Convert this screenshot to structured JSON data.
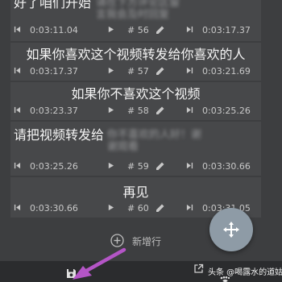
{
  "rows": [
    {
      "subtitle": "好了咱们开始",
      "subtitle_blurred": "请在下方评论区留言我会及时回复",
      "start_time": "0:03:11.04",
      "index": "# 56",
      "end_time": "0:03:17.37"
    },
    {
      "subtitle": "如果你喜欢这个视频转发给你喜欢的人",
      "start_time": "0:03:17.37",
      "index": "# 57",
      "end_time": "0:03:21.69"
    },
    {
      "subtitle": "如果你不喜欢这个视频",
      "start_time": "0:03:23.37",
      "index": "# 58",
      "end_time": "0:03:25.26"
    },
    {
      "subtitle": "请把视频转发给",
      "subtitle_blurred": "你不喜欢的人好！谢谢观看",
      "start_time": "0:03:25.26",
      "index": "# 59",
      "end_time": "0:03:30.66"
    },
    {
      "subtitle": "再见",
      "start_time": "0:03:30.66",
      "index": "# 60",
      "end_time": "0:03:31.05"
    }
  ],
  "add_row_label": "新增行",
  "watermark": "头条 @喝露水的道姑",
  "colors": {
    "background": "#3d3e40",
    "card": "#47484a",
    "fab": "#8e9ba6",
    "arrow": "#b455c6"
  },
  "icons": [
    "skip-start-icon",
    "play-icon",
    "pencil-icon",
    "skip-end-icon",
    "add-circle-icon",
    "move-arrows-icon",
    "save-icon",
    "open-external-icon",
    "paw-icon"
  ]
}
